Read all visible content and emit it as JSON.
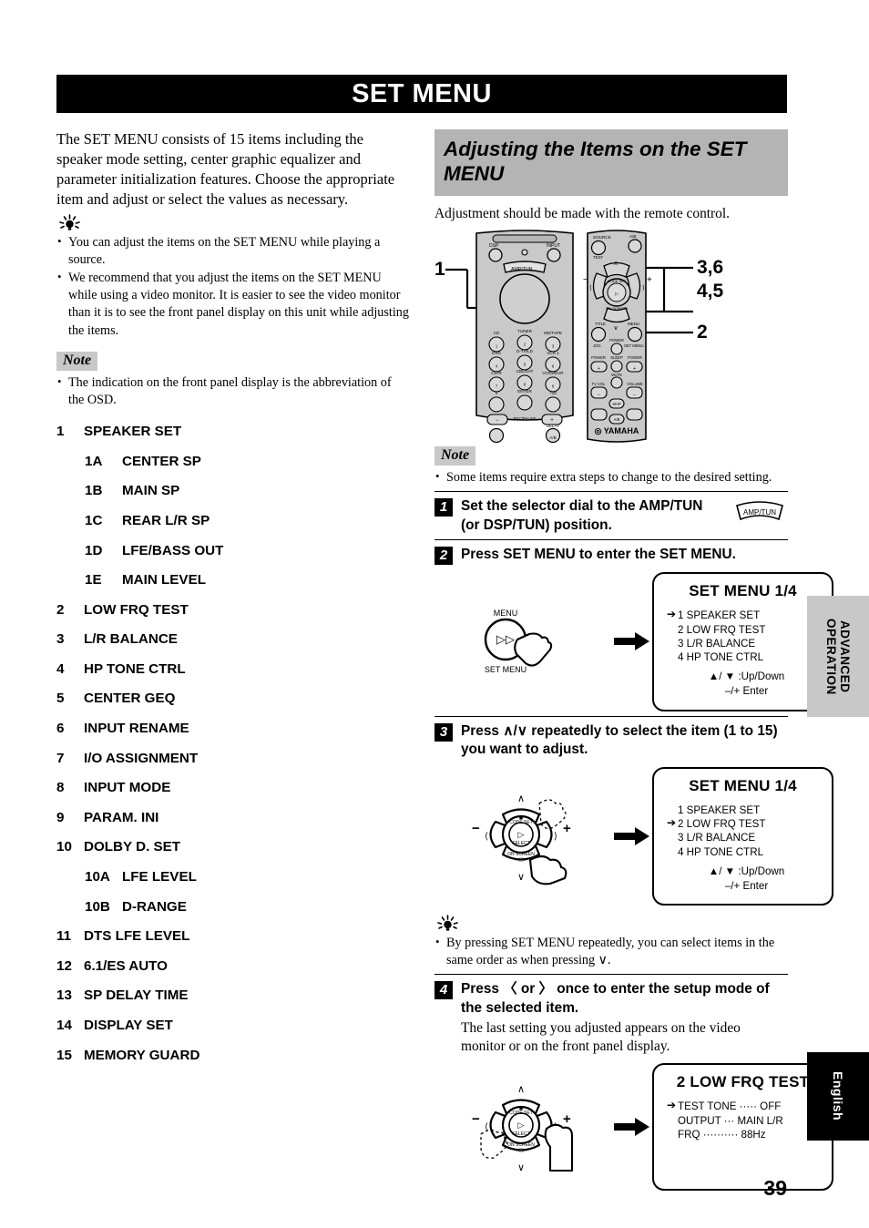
{
  "page": {
    "title": "SET MENU",
    "page_number": "39"
  },
  "left": {
    "intro": "The SET MENU consists of 15 items including the speaker mode setting, center graphic equalizer and parameter initialization features. Choose the appropriate item and adjust or select the values as necessary.",
    "tip_icon": "lightbulb-icon",
    "tips": [
      "You can adjust the items on the SET MENU while playing a source.",
      "We recommend that you adjust the items on the SET MENU while using a video monitor. It is easier to see the video monitor than it is to see the front panel display on this unit while adjusting the items."
    ],
    "note_label": "Note",
    "notes": [
      "The indication on the front panel display is the abbreviation of the OSD."
    ],
    "menu_items": [
      {
        "num": "1",
        "label": "SPEAKER SET",
        "sub": false
      },
      {
        "num": "1A",
        "label": "CENTER SP",
        "sub": true
      },
      {
        "num": "1B",
        "label": "MAIN SP",
        "sub": true
      },
      {
        "num": "1C",
        "label": "REAR L/R SP",
        "sub": true
      },
      {
        "num": "1D",
        "label": "LFE/BASS OUT",
        "sub": true
      },
      {
        "num": "1E",
        "label": "MAIN LEVEL",
        "sub": true
      },
      {
        "num": "2",
        "label": "LOW FRQ TEST",
        "sub": false
      },
      {
        "num": "3",
        "label": "L/R BALANCE",
        "sub": false
      },
      {
        "num": "4",
        "label": "HP TONE CTRL",
        "sub": false
      },
      {
        "num": "5",
        "label": "CENTER GEQ",
        "sub": false
      },
      {
        "num": "6",
        "label": "INPUT RENAME",
        "sub": false
      },
      {
        "num": "7",
        "label": "I/O ASSIGNMENT",
        "sub": false
      },
      {
        "num": "8",
        "label": "INPUT MODE",
        "sub": false
      },
      {
        "num": "9",
        "label": "PARAM. INI",
        "sub": false
      },
      {
        "num": "10",
        "label": "DOLBY D. SET",
        "sub": false
      },
      {
        "num": "10A",
        "label": "LFE LEVEL",
        "sub": true
      },
      {
        "num": "10B",
        "label": "D-RANGE",
        "sub": true
      },
      {
        "num": "11",
        "label": "DTS LFE LEVEL",
        "sub": false
      },
      {
        "num": "12",
        "label": "6.1/ES AUTO",
        "sub": false
      },
      {
        "num": "13",
        "label": "SP DELAY TIME",
        "sub": false
      },
      {
        "num": "14",
        "label": "DISPLAY SET",
        "sub": false
      },
      {
        "num": "15",
        "label": "MEMORY GUARD",
        "sub": false
      }
    ]
  },
  "right": {
    "section_title": "Adjusting the Items on the SET MENU",
    "lead": "Adjustment should be made with the remote control.",
    "remote": {
      "brand": "YAMAHA",
      "callouts": [
        "1",
        "3,6",
        "4,5",
        "2"
      ],
      "left_unit_labels": [
        "DSP",
        "INPUT",
        "AMP/TUN",
        "CD",
        "TUNER",
        "MD/TAPE",
        "DVD",
        "DTV/LD",
        "VCR 1",
        "CD-R",
        "CBL/SAT",
        "VCR 2/DVR",
        "ENTER",
        "+10",
        "REC/PAUSE",
        "PRESET",
        "A/B"
      ],
      "right_unit_labels": [
        "TEST",
        "A/B",
        "POWER",
        "SLEEP",
        "MUTE",
        "TV VOL",
        "VOLUME",
        "SET MENU",
        "ON SCREEN",
        "SELECT"
      ]
    },
    "note_label": "Note",
    "notes": [
      "Some items require extra steps to change to the desired setting."
    ],
    "steps": [
      {
        "num": "1",
        "text": "Set the selector dial to the AMP/TUN (or DSP/TUN) position.",
        "dial_label": "AMP/TUN"
      },
      {
        "num": "2",
        "text": "Press SET MENU to enter the SET MENU.",
        "button_top_label": "MENU",
        "button_bottom_label": "SET MENU"
      },
      {
        "num": "3",
        "text": "Press ∧/∨ repeatedly to select the item (1 to 15) you want to adjust."
      },
      {
        "num": "4",
        "text": "Press 〈 or 〉 once to enter the setup mode of the selected item.",
        "sub": "The last setting you adjusted appears on the video monitor or on the front panel display."
      }
    ],
    "tip_mid": "By pressing SET MENU repeatedly, you can select items in the same order as when pressing ∨.",
    "pad_labels": {
      "minus": "−",
      "plus": "+"
    },
    "osd_screens": [
      {
        "title": "SET MENU  1/4",
        "arrow_index": 0,
        "lines": [
          "1 SPEAKER SET",
          "2 LOW FRQ TEST",
          "3 L/R BALANCE",
          "4 HP TONE CTRL"
        ],
        "foot1": "▲/ ▼ :Up/Down",
        "foot2": "–/+ Enter"
      },
      {
        "title": "SET MENU  1/4",
        "arrow_index": 1,
        "lines": [
          "1 SPEAKER SET",
          "2 LOW FRQ TEST",
          "3 L/R BALANCE",
          "4 HP TONE CTRL"
        ],
        "foot1": "▲/ ▼ :Up/Down",
        "foot2": "–/+ Enter"
      },
      {
        "title": "2 LOW FRQ TEST",
        "arrow_index": 0,
        "lines": [
          "TEST TONE ····· OFF",
          "OUTPUT ··· MAIN L/R",
          "FRQ ·········· 88Hz"
        ],
        "foot1": "",
        "foot2": ""
      }
    ]
  },
  "tabs": {
    "advanced": "ADVANCED\nOPERATION",
    "advanced_line1": "ADVANCED",
    "advanced_line2": "OPERATION",
    "english": "English"
  }
}
